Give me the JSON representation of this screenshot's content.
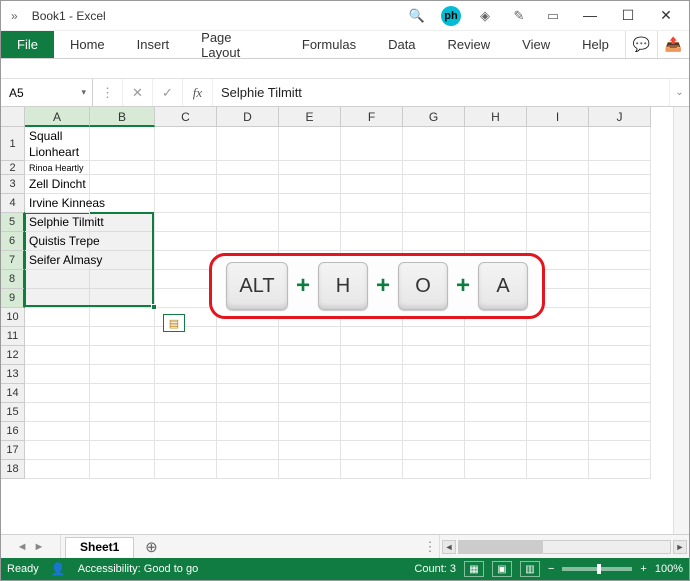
{
  "titlebar": {
    "title": "Book1  -  Excel",
    "ph_label": "ph",
    "premium_icon": "◈",
    "pen_icon": "✎",
    "panel_icon": "▭",
    "min": "—",
    "max": "☐",
    "close": "✕"
  },
  "tabs": {
    "file": "File",
    "home": "Home",
    "insert": "Insert",
    "page_layout": "Page Layout",
    "formulas": "Formulas",
    "data": "Data",
    "review": "Review",
    "view": "View",
    "help": "Help",
    "comments": "💬",
    "share": "📤"
  },
  "fbar": {
    "namebox": "A5",
    "dropdown": "▾",
    "cancel": "✕",
    "enter": "✓",
    "fx": "fx",
    "formula": "Selphie Tilmitt",
    "expand": "⌄"
  },
  "columns": [
    "A",
    "B",
    "C",
    "D",
    "E",
    "F",
    "G",
    "H",
    "I",
    "J"
  ],
  "row_count": 18,
  "cells": {
    "r1": "Squall Lionheart",
    "r2": "Rinoa Heartly",
    "r3": "Zell Dincht",
    "r4": "Irvine Kinneas",
    "r5": "Selphie Tilmitt",
    "r6": "Quistis Trepe",
    "r7": "Seifer Almasy"
  },
  "keys": {
    "k1": "ALT",
    "k2": "H",
    "k3": "O",
    "k4": "A",
    "plus": "+"
  },
  "sheetbar": {
    "nav_prev": "◄",
    "nav_next": "►",
    "sheet1": "Sheet1",
    "add": "⊕",
    "sep": "⋮",
    "hs_left": "◄",
    "hs_right": "►"
  },
  "status": {
    "ready": "Ready",
    "acc": "Accessibility: Good to go",
    "count": "Count: 3",
    "zoom_minus": "−",
    "zoom_plus": "+",
    "zoom": "100%"
  },
  "qa": "▤"
}
